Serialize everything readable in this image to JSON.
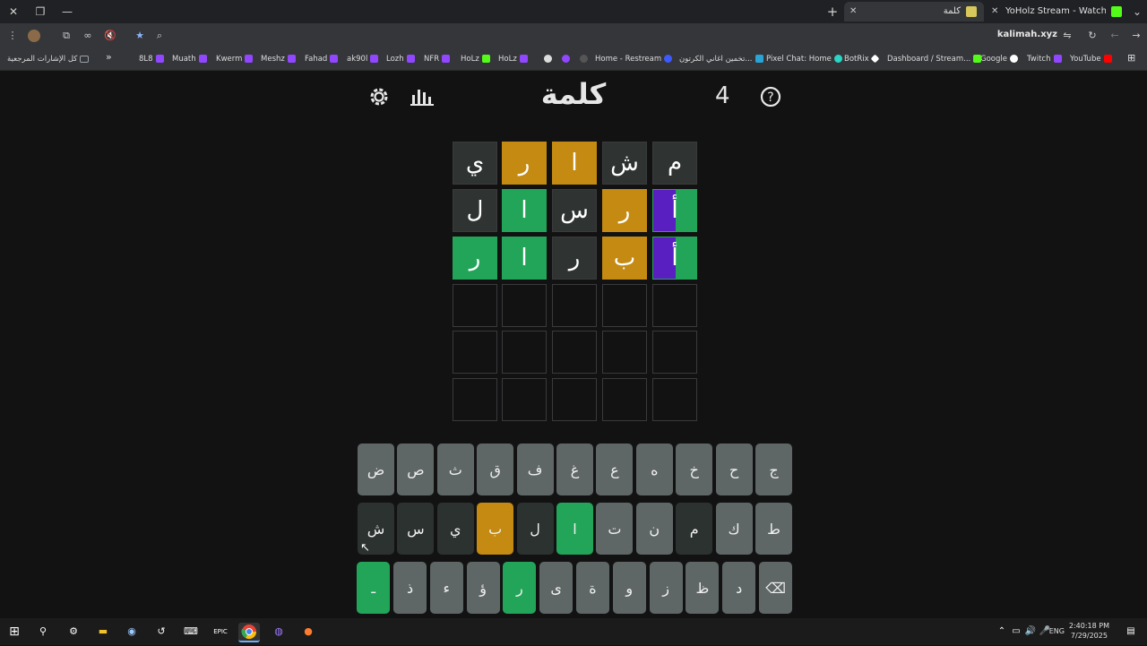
{
  "browser": {
    "window_controls": {
      "close": "✕",
      "restore": "❐",
      "minimize": "—"
    },
    "tabs": [
      {
        "title": "كلمة",
        "active": true
      },
      {
        "title": "YoHolz Stream - Watch Live on",
        "active": false
      }
    ],
    "new_tab": "+",
    "url": "kalimah.xyz",
    "bookmarks": [
      {
        "label": "كل الإشارات المرجعية",
        "color": "#9aa0a6"
      },
      {
        "label": "»",
        "color": ""
      },
      {
        "label": "8L8",
        "color": "#9146ff"
      },
      {
        "label": "Muath",
        "color": "#9146ff"
      },
      {
        "label": "Kwerm",
        "color": "#9146ff"
      },
      {
        "label": "Meshz",
        "color": "#9146ff"
      },
      {
        "label": "Fahad",
        "color": "#9146ff"
      },
      {
        "label": "ak90l",
        "color": "#9146ff"
      },
      {
        "label": "Lozh",
        "color": "#9146ff"
      },
      {
        "label": "NFR",
        "color": "#9146ff"
      },
      {
        "label": "HoLz",
        "color": "#53fc18"
      },
      {
        "label": "HoLz",
        "color": "#9146ff"
      },
      {
        "label": "Home - Restream",
        "color": "#3d5afe"
      },
      {
        "label": "تخمين اغاني الكرتون...",
        "color": "#2aa3d6"
      },
      {
        "label": "Pixel Chat: Home",
        "color": "#2ad6c5"
      },
      {
        "label": "BotRix",
        "color": "#ffffff"
      },
      {
        "label": "Dashboard / Stream...",
        "color": "#53fc18"
      },
      {
        "label": "Google",
        "color": "#ffffff"
      },
      {
        "label": "Twitch",
        "color": "#9146ff"
      },
      {
        "label": "YouTube",
        "color": "#ff0000"
      }
    ]
  },
  "game": {
    "title": "كلمة",
    "streak": "4",
    "colors": {
      "correct": "#23a559",
      "present": "#c48a12",
      "absent": "#2f3432",
      "hint": "#5a1fc0"
    },
    "board": [
      [
        {
          "l": "م",
          "s": "absent"
        },
        {
          "l": "ش",
          "s": "absent"
        },
        {
          "l": "ا",
          "s": "present"
        },
        {
          "l": "ر",
          "s": "present"
        },
        {
          "l": "ي",
          "s": "absent"
        }
      ],
      [
        {
          "l": "أ",
          "s": "mixed"
        },
        {
          "l": "ر",
          "s": "present"
        },
        {
          "l": "س",
          "s": "absent"
        },
        {
          "l": "ا",
          "s": "correct"
        },
        {
          "l": "ل",
          "s": "absent"
        }
      ],
      [
        {
          "l": "أ",
          "s": "mixed"
        },
        {
          "l": "ب",
          "s": "present"
        },
        {
          "l": "ر",
          "s": "absent"
        },
        {
          "l": "ا",
          "s": "correct"
        },
        {
          "l": "ر",
          "s": "correct"
        }
      ],
      [
        {
          "l": "",
          "s": "empty"
        },
        {
          "l": "",
          "s": "empty"
        },
        {
          "l": "",
          "s": "empty"
        },
        {
          "l": "",
          "s": "empty"
        },
        {
          "l": "",
          "s": "empty"
        }
      ],
      [
        {
          "l": "",
          "s": "empty"
        },
        {
          "l": "",
          "s": "empty"
        },
        {
          "l": "",
          "s": "empty"
        },
        {
          "l": "",
          "s": "empty"
        },
        {
          "l": "",
          "s": "empty"
        }
      ],
      [
        {
          "l": "",
          "s": "empty"
        },
        {
          "l": "",
          "s": "empty"
        },
        {
          "l": "",
          "s": "empty"
        },
        {
          "l": "",
          "s": "empty"
        },
        {
          "l": "",
          "s": "empty"
        }
      ]
    ],
    "keyboard": [
      [
        {
          "k": "ج",
          "s": "unused"
        },
        {
          "k": "ح",
          "s": "unused"
        },
        {
          "k": "خ",
          "s": "unused"
        },
        {
          "k": "ه",
          "s": "unused"
        },
        {
          "k": "ع",
          "s": "unused"
        },
        {
          "k": "غ",
          "s": "unused"
        },
        {
          "k": "ف",
          "s": "unused"
        },
        {
          "k": "ق",
          "s": "unused"
        },
        {
          "k": "ث",
          "s": "unused"
        },
        {
          "k": "ص",
          "s": "unused"
        },
        {
          "k": "ض",
          "s": "unused"
        }
      ],
      [
        {
          "k": "ط",
          "s": "unused"
        },
        {
          "k": "ك",
          "s": "unused"
        },
        {
          "k": "م",
          "s": "absent"
        },
        {
          "k": "ن",
          "s": "unused"
        },
        {
          "k": "ت",
          "s": "unused"
        },
        {
          "k": "ا",
          "s": "correct"
        },
        {
          "k": "ل",
          "s": "absent"
        },
        {
          "k": "ب",
          "s": "present"
        },
        {
          "k": "ي",
          "s": "absent"
        },
        {
          "k": "س",
          "s": "absent"
        },
        {
          "k": "ش",
          "s": "absent"
        }
      ],
      [
        {
          "k": "⌫",
          "s": "unused"
        },
        {
          "k": "د",
          "s": "unused"
        },
        {
          "k": "ظ",
          "s": "unused"
        },
        {
          "k": "ز",
          "s": "unused"
        },
        {
          "k": "و",
          "s": "unused"
        },
        {
          "k": "ة",
          "s": "unused"
        },
        {
          "k": "ى",
          "s": "unused"
        },
        {
          "k": "ر",
          "s": "correct"
        },
        {
          "k": "ؤ",
          "s": "unused"
        },
        {
          "k": "ء",
          "s": "unused"
        },
        {
          "k": "ذ",
          "s": "unused"
        },
        {
          "k": "ـ",
          "s": "correct"
        }
      ]
    ]
  },
  "taskbar": {
    "lang": "ENG",
    "time": "2:40:18 PM",
    "date": "7/29/2025"
  }
}
